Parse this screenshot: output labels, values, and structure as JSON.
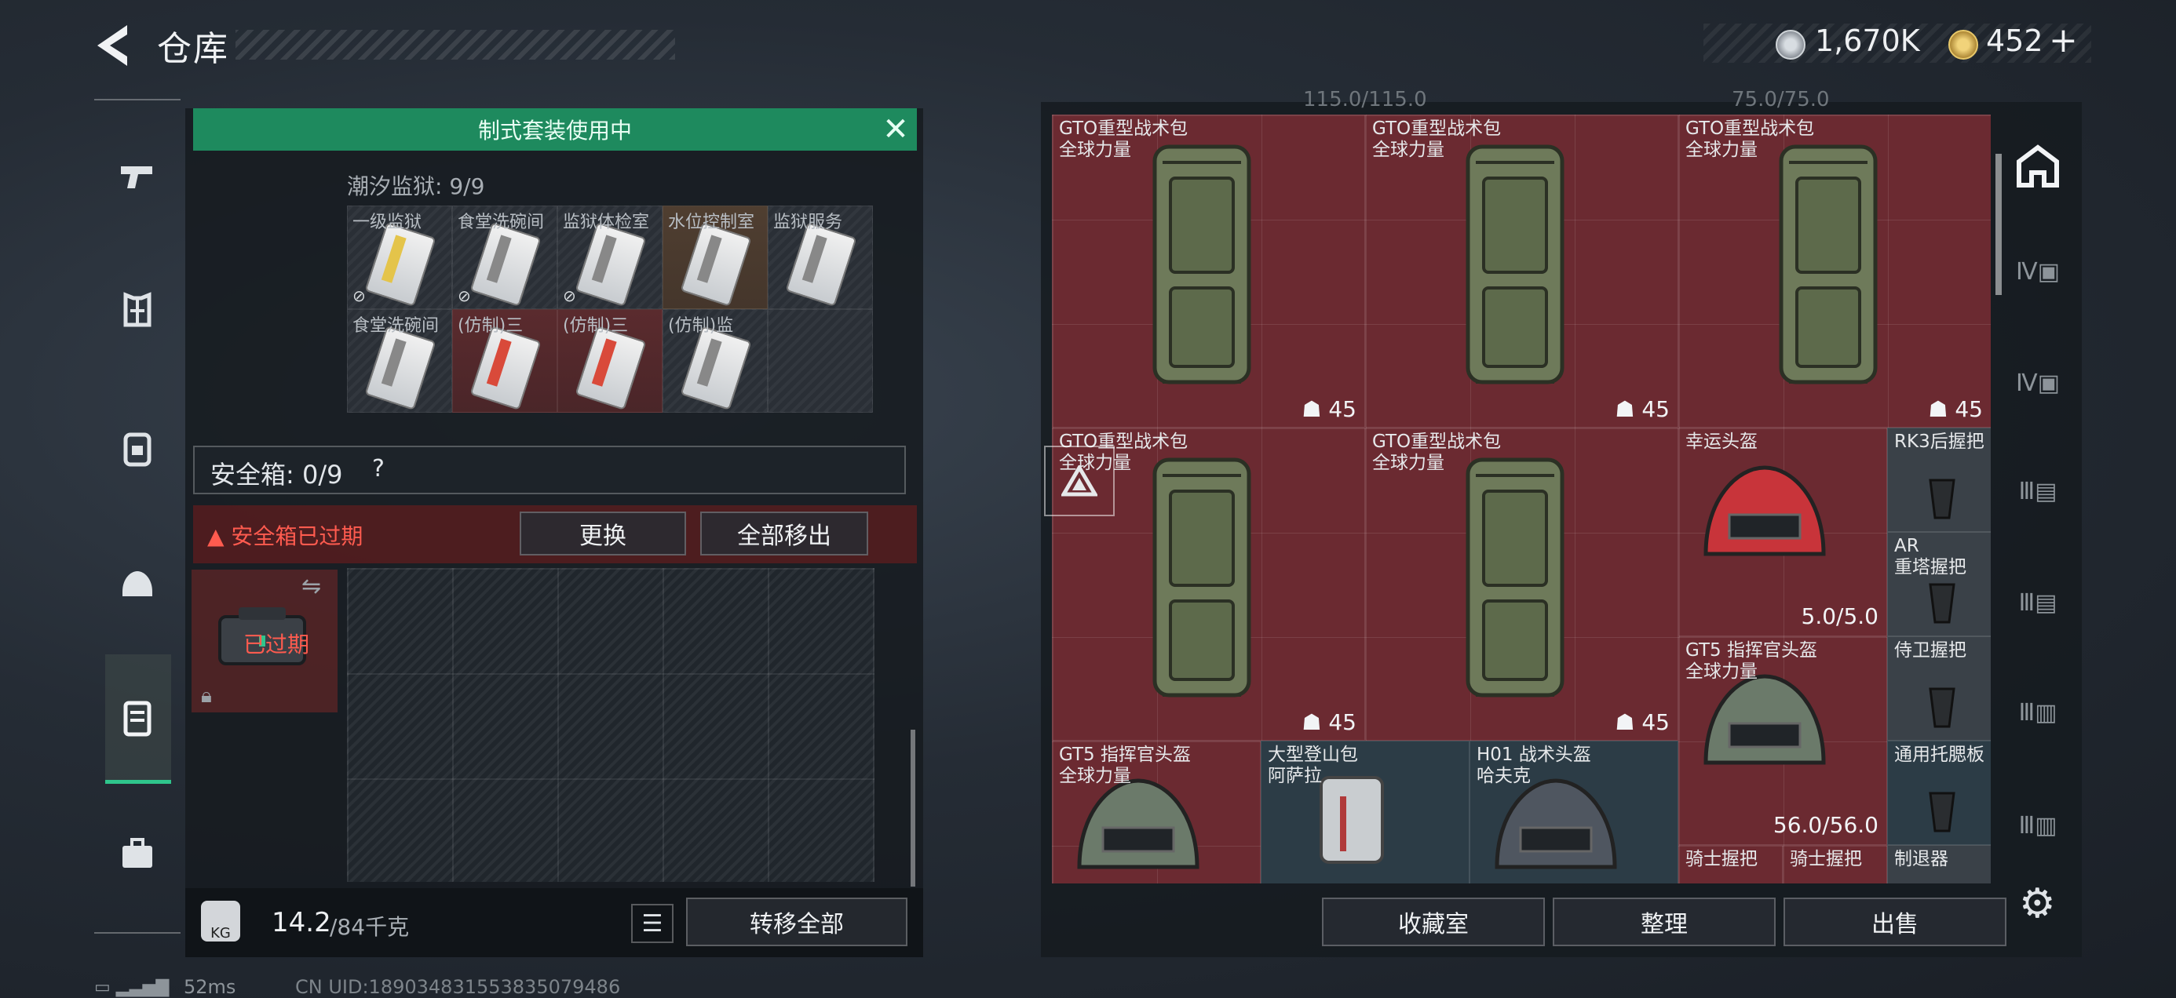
{
  "header": {
    "title": "仓库",
    "silver_value": "1,670K",
    "gold_value": "452",
    "plus": "+"
  },
  "banner": {
    "text": "制式套装使用中",
    "close": "✕"
  },
  "prison": {
    "count_text": "潮汐监狱: 9/9",
    "cards": [
      {
        "label": "一级监狱",
        "tone": "gray",
        "stripe": "yellow",
        "locked": true
      },
      {
        "label": "食堂洗碗间",
        "tone": "gray",
        "stripe": "gray",
        "locked": true
      },
      {
        "label": "监狱体检室",
        "tone": "gray",
        "stripe": "gray",
        "locked": true
      },
      {
        "label": "水位控制室",
        "tone": "brown",
        "stripe": "gray",
        "locked": false
      },
      {
        "label": "监狱服务",
        "tone": "gray",
        "stripe": "gray",
        "locked": false
      },
      {
        "label": "食堂洗碗间",
        "tone": "gray",
        "stripe": "gray",
        "locked": false
      },
      {
        "label": "(仿制)三",
        "tone": "red",
        "stripe": "red",
        "locked": false
      },
      {
        "label": "(仿制)三",
        "tone": "red",
        "stripe": "red",
        "locked": false
      },
      {
        "label": "(仿制)监",
        "tone": "gray",
        "stripe": "gray",
        "locked": false
      }
    ]
  },
  "safebox": {
    "label": "安全箱: 0/9",
    "help": "?",
    "expired_text": "▲ 安全箱已过期",
    "replace_label": "更换",
    "move_all_label": "全部移出",
    "case_status": "已过期"
  },
  "footer_left": {
    "weight_value": "14.2",
    "weight_max": "/84千克",
    "weight_icon_text": "KG",
    "transfer_label": "转移全部"
  },
  "status": {
    "ping": "52ms",
    "uid": "CN UID:1890348315538350794​86"
  },
  "stash": {
    "top_text_1": "115.0/115.0",
    "top_text_2": "75.0/75.0",
    "items": [
      {
        "name": "GTO重型战术包",
        "sub": "全球力量",
        "count": "45"
      },
      {
        "name": "GTO重型战术包",
        "sub": "全球力量",
        "count": "45"
      },
      {
        "name": "GTO重型战术包",
        "sub": "全球力量",
        "count": "45"
      },
      {
        "name": "GTO重型战术包",
        "sub": "全球力量",
        "count": "45"
      },
      {
        "name": "GTO重型战术包",
        "sub": "全球力量",
        "count": "45"
      },
      {
        "name": "幸运头盔",
        "durability": "5.0/5.0"
      },
      {
        "name": "RK3后握把"
      },
      {
        "name": "AR",
        "sub": "重塔握把"
      },
      {
        "name": "GT5 指挥官头盔",
        "sub": "全球力量",
        "durability": "56.0/56.0"
      },
      {
        "name": "侍卫握把"
      },
      {
        "name": "通用托腮板"
      },
      {
        "name": "GT5 指挥官头盔",
        "sub": "全球力量"
      },
      {
        "name": "大型登山包",
        "sub": "阿萨拉"
      },
      {
        "name": "H01 战术头盔",
        "sub": "哈夫克"
      },
      {
        "name": "骑士握把"
      },
      {
        "name": "骑士握把"
      },
      {
        "name": "制退器"
      }
    ]
  },
  "actions": {
    "collection_label": "收藏室",
    "sort_label": "整理",
    "sell_label": "出售"
  },
  "colors": {
    "accent_green": "#1e8a5e",
    "alert_red": "#ff5b4f",
    "tile_red": "#6b2a31"
  }
}
